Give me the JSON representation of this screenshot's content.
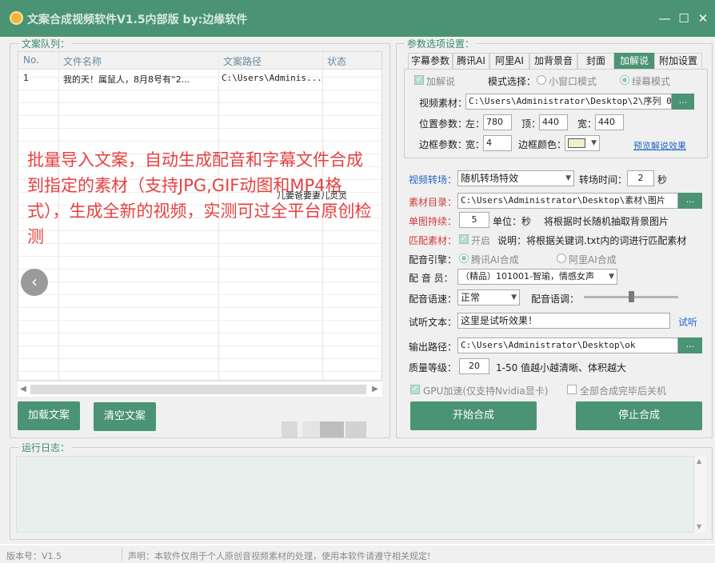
{
  "window": {
    "title": "文案合成视频软件V1.5内部版  by:边缘软件",
    "controls": {
      "minimize": "—",
      "maximize": "☐",
      "close": "✕"
    }
  },
  "queue": {
    "group_title": "文案队列：",
    "columns": [
      "No.",
      "文件名称",
      "文案路径",
      "状态"
    ],
    "rows": [
      {
        "no": "1",
        "name": "我的天！属鼠人，8月8号有“2...",
        "path": "C:\\Users\\Adminis...",
        "status": ""
      }
    ],
    "overlay_text": "批量导入文案，自动生成配音和字幕文件合成到指定的素材（支持JPG,GIF动图和MP4格式），生成全新的视频，实测可过全平台原创检测",
    "overlay_small": "儿要爸要妻儿灵灵",
    "nav_prev": "‹",
    "load_button": "加载文案",
    "clear_button": "清空文案"
  },
  "params": {
    "group_title": "参数选项设置：",
    "tabs": [
      "字幕参数",
      "腾讯AI",
      "阿里AI",
      "加背景音",
      "封面",
      "加解说",
      "附加设置"
    ],
    "active_tab": 5,
    "narration": {
      "enable_label": "加解说",
      "mode_label": "模式选择：",
      "mode_small": "小窗口模式",
      "mode_full": "绿幕模式",
      "material_label": "视频素材：",
      "material_path": "C:\\Users\\Administrator\\Desktop\\2\\序列 03.m",
      "browse": "...",
      "position_label": "位置参数：",
      "left_label": "左：",
      "left_value": "780",
      "top_label": "顶：",
      "top_value": "440",
      "width_label": "宽：",
      "width_value": "440",
      "border_label": "边框参数：",
      "border_width_label": "宽：",
      "border_width_value": "4",
      "border_color_label": "边框颜色：",
      "border_color": "#f3efc9",
      "preview_link": "预览解说效果"
    },
    "transition_label": "视频转场：",
    "transition_value": "随机转场特效",
    "transition_time_label": "转场时间：",
    "transition_time_value": "2",
    "transition_time_unit": "秒",
    "material_dir_label": "素材目录：",
    "material_dir_value": "C:\\Users\\Administrator\\Desktop\\素材\\图片",
    "single_label": "单图持续：",
    "single_value": "5",
    "single_unit": "单位：秒",
    "single_hint": "将根据时长随机抽取背景图片",
    "match_label": "匹配素材：",
    "match_enable": "开启",
    "match_hint": "说明：将根据关键词.txt内的词进行匹配素材",
    "engine_label": "配音引擎：",
    "engine_tencent": "腾讯AI合成",
    "engine_ali": "阿里AI合成",
    "voice_label": "配 音 员：",
    "voice_value": "（精品）101001-智瑜，情感女声",
    "speed_label": "配音语速：",
    "speed_value": "正常",
    "pitch_label": "配音语调：",
    "pitch_level": 0.5,
    "test_label": "试听文本：",
    "test_value": "这里是试听效果！",
    "test_link": "试听",
    "output_label": "输出路径：",
    "output_value": "C:\\Users\\Administrator\\Desktop\\ok",
    "quality_label": "质量等级：",
    "quality_value": "20",
    "quality_hint": "1-50 值越小越清晰、体积越大",
    "gpu_label": "GPU加速(仅支持Nvidia显卡)",
    "shutdown_label": "全部合成完毕后关机",
    "start_button": "开始合成",
    "stop_button": "停止合成"
  },
  "log": {
    "group_title": "运行日志："
  },
  "status": {
    "version": "版本号：V1.5",
    "notice": "声明：本软件仅用于个人原创音视频素材的处理，使用本软件请遵守相关规定!"
  },
  "colors": {
    "accent": "#4a9374",
    "label_red": "#d23a3a",
    "label_blue": "#2465c8",
    "overlay_red": "#e64040"
  }
}
